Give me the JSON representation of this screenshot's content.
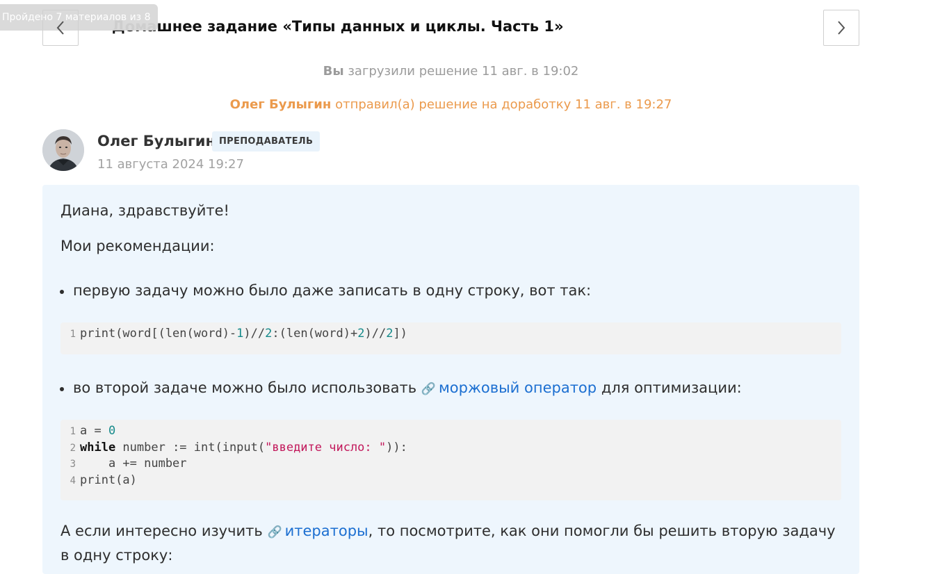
{
  "progress": {
    "tooltip": "Пройдено 7 материалов из 8",
    "done": 7,
    "total": 8
  },
  "header": {
    "title": "Домашнее задание «Типы данных и циклы. Часть 1»"
  },
  "events": {
    "upload": {
      "actor": "Вы",
      "text": "загрузили решение 11 авг. в 19:02"
    },
    "review": {
      "actor": "Олег Булыгин",
      "text": "отправил(а) решение на доработку 11 авг. в 19:27"
    }
  },
  "comment": {
    "author": "Олег Булыгин",
    "role": "ПРЕПОДАВАТЕЛЬ",
    "timestamp": "11 августа 2024 19:27",
    "greeting": "Диана, здравствуйте!",
    "recs_title": "Мои рекомендации:",
    "bullet1": "первую задачу можно было даже записать в одну строку, вот так:",
    "code1": [
      {
        "n": "1",
        "text": "print(word[(len(word)-1)//2:(len(word)+2)//2])"
      }
    ],
    "bullet2_before": "во второй задаче можно было использовать",
    "bullet2_link": "моржовый оператор",
    "bullet2_after": "для оптимизации:",
    "code2": [
      {
        "n": "1",
        "text": "a = 0"
      },
      {
        "n": "2",
        "text": "while number := int(input(\"введите число: \")):"
      },
      {
        "n": "3",
        "text": "    a += number"
      },
      {
        "n": "4",
        "text": "print(a)"
      }
    ],
    "para_before": "А если интересно изучить",
    "para_link": "итераторы",
    "para_after": ", то посмотрите, как они помогли бы решить вторую задачу в одну строку:"
  },
  "colors": {
    "accent_link": "#1c6fd1",
    "review_orange": "#eb9a4c",
    "card_bg": "#eef6fd"
  },
  "icons": {
    "prev": "chevron-left-icon",
    "next": "chevron-right-icon",
    "link": "link-icon"
  }
}
